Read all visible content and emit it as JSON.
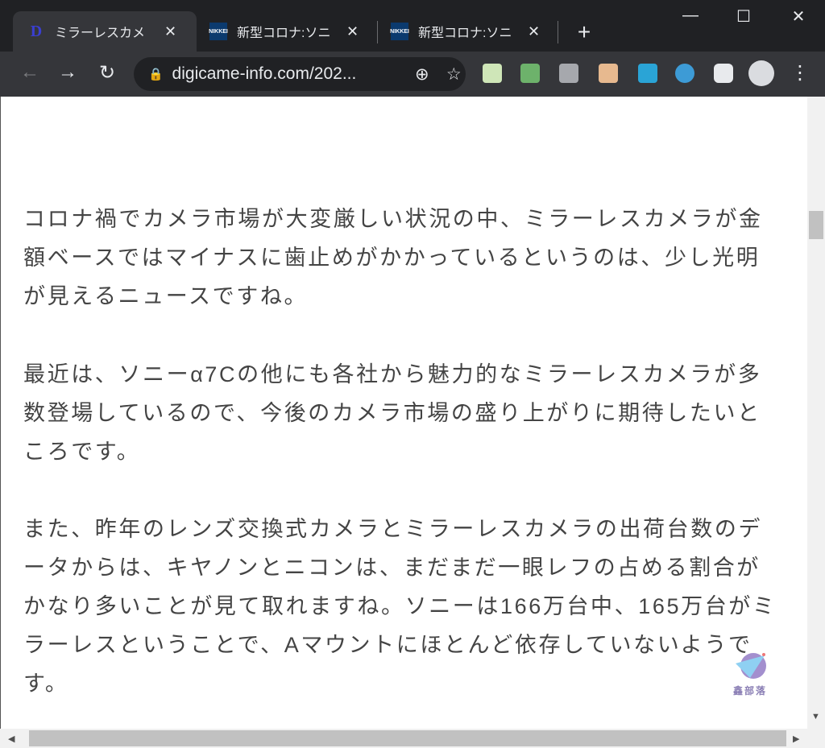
{
  "tabs": [
    {
      "title": "ミラーレスカメ",
      "favicon": "D"
    },
    {
      "title": "新型コロナ:ソニ",
      "favicon": "NIKKEI"
    },
    {
      "title": "新型コロナ:ソニ",
      "favicon": "NIKKEI"
    }
  ],
  "new_tab": "+",
  "close_glyph": "✕",
  "window": {
    "minimize": "—",
    "maximize": "☐",
    "close": "✕"
  },
  "nav": {
    "back": "←",
    "forward": "→",
    "reload": "↻"
  },
  "url": "digicame-info.com/202...",
  "omnibox_icons": {
    "lock": "🔒",
    "zoom": "⊕",
    "star": "☆"
  },
  "menu": "⋮",
  "paragraphs": [
    [
      "コロナ禍でカメラ市場が大変厳しい状況の中、ミラーレスカメラが金",
      "額ベースではマイナスに歯止めがかかっているというのは、少し光明",
      "が見えるニュースですね。"
    ],
    [
      "最近は、ソニーα7Cの他にも各社から魅力的なミラーレスカメラが多",
      "数登場しているので、今後のカメラ市場の盛り上がりに期待したいと",
      "ころです。"
    ],
    [
      "また、昨年のレンズ交換式カメラとミラーレスカメラの出荷台数のデ",
      "ータからは、キヤノンとニコンは、まだまだ一眼レフの占める割合が",
      "かなり多いことが見て取れますね。ソニーは166万台中、165万台がミ",
      "ラーレスということで、Aマウントにほとんど依存していないようで",
      "す。"
    ]
  ],
  "watermark": "鑫部落"
}
